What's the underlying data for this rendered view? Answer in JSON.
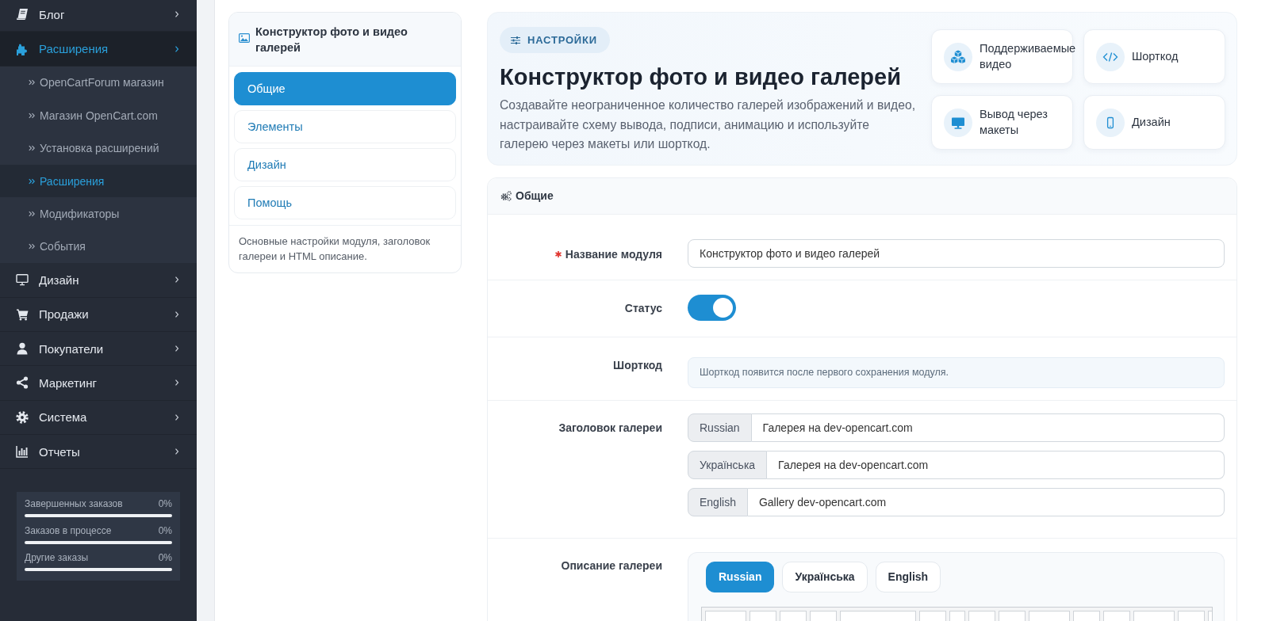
{
  "sidebar": {
    "items": [
      {
        "label": "Блог",
        "selected": false
      },
      {
        "label": "Расширения",
        "selected": true,
        "children": [
          {
            "label": "OpenCartForum магазин",
            "selected": false
          },
          {
            "label": "Магазин OpenCart.com",
            "selected": false
          },
          {
            "label": "Установка расширений",
            "selected": false
          },
          {
            "label": "Расширения",
            "selected": true
          },
          {
            "label": "Модификаторы",
            "selected": false
          },
          {
            "label": "События",
            "selected": false
          }
        ]
      },
      {
        "label": "Дизайн",
        "selected": false
      },
      {
        "label": "Продажи",
        "selected": false
      },
      {
        "label": "Покупатели",
        "selected": false
      },
      {
        "label": "Маркетинг",
        "selected": false
      },
      {
        "label": "Система",
        "selected": false
      },
      {
        "label": "Отчеты",
        "selected": false
      }
    ],
    "order_stats": [
      {
        "label": "Завершенных заказов",
        "value": "0%",
        "level": 0
      },
      {
        "label": "Заказов в процессе",
        "value": "0%",
        "level": 0
      },
      {
        "label": "Другие заказы",
        "value": "0%",
        "level": 0
      }
    ]
  },
  "module_nav": {
    "title": "Конструктор фото и видео галерей",
    "items": [
      {
        "label": "Общие",
        "selected": true
      },
      {
        "label": "Элементы",
        "selected": false
      },
      {
        "label": "Дизайн",
        "selected": false
      },
      {
        "label": "Помощь",
        "selected": false
      }
    ],
    "description": "Основные настройки модуля, заголовок галереи и HTML описание."
  },
  "hero": {
    "badge": "НАСТРОЙКИ",
    "title": "Конструктор фото и видео галерей",
    "description": "Создавайте неограниченное количество галерей изображений и видео, настраивайте схему вывода, подписи, анимацию и используйте галерею через макеты или шорткод.",
    "features": [
      {
        "label": "Поддерживаемые видео"
      },
      {
        "label": "Шорткод"
      },
      {
        "label": "Вывод через макеты"
      },
      {
        "label": "Дизайн"
      }
    ]
  },
  "form": {
    "title": "Общие",
    "fields": [
      {
        "kind": "text",
        "label": "Название модуля",
        "required": true,
        "value": "Конструктор фото и видео галерей"
      },
      {
        "kind": "toggle",
        "label": "Статус",
        "required": false,
        "on": true
      },
      {
        "kind": "note",
        "label": "Шорткод",
        "required": false,
        "text": "Шорткод появится после первого сохранения модуля."
      },
      {
        "kind": "multilang",
        "label": "Заголовок галереи",
        "required": false,
        "inputs": [
          {
            "language": "Russian",
            "value": "Галерея на dev-opencart.com"
          },
          {
            "language": "Українська",
            "value": "Галерея на dev-opencart.com"
          },
          {
            "language": "English",
            "value": "Gallery dev-opencart.com"
          }
        ]
      },
      {
        "kind": "editor",
        "label": "Описание галереи",
        "required": false,
        "tabs": [
          {
            "label": "Russian",
            "selected": true
          },
          {
            "label": "Українська",
            "selected": false
          },
          {
            "label": "English",
            "selected": false
          }
        ]
      }
    ]
  }
}
